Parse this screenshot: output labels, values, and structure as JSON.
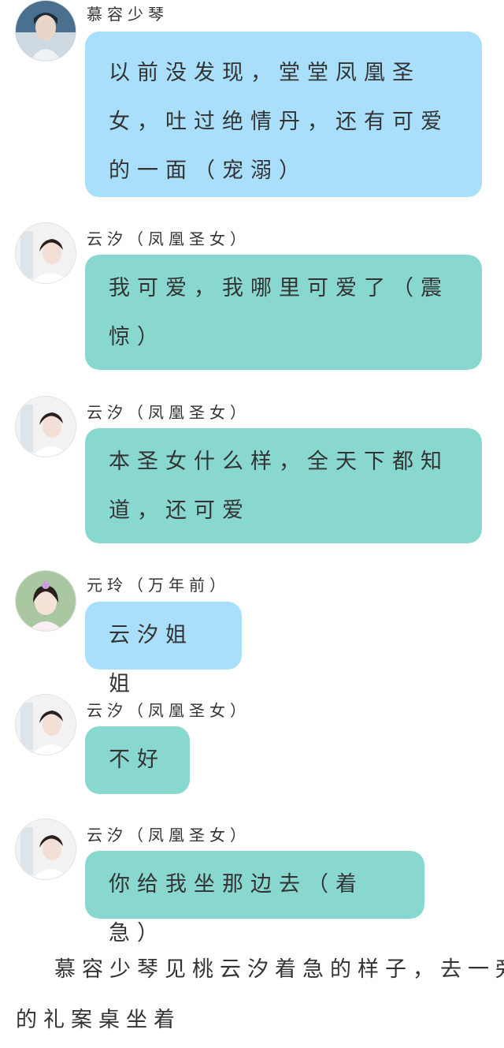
{
  "messages": [
    {
      "speaker": "慕容少琴",
      "text": "以前没发现，堂堂凤凰圣女，吐过绝情丹，还有可爱的一面（宠溺）",
      "color": "#a9dffb",
      "avatar": "male-portrait"
    },
    {
      "speaker": "云汐（凤凰圣女）",
      "text": "我可爱，我哪里可爱了（震惊）",
      "color": "#89d8cf",
      "avatar": "female-portrait"
    },
    {
      "speaker": "云汐（凤凰圣女）",
      "text": "本圣女什么样，全天下都知道，还可爱",
      "color": "#89d8cf",
      "avatar": "female-portrait"
    },
    {
      "speaker": "元玲（万年前）",
      "text": "云汐姐姐",
      "color": "#a9dffb",
      "avatar": "female-portrait-2"
    },
    {
      "speaker": "云汐（凤凰圣女）",
      "text": "不好",
      "color": "#89d8cf",
      "avatar": "female-portrait"
    },
    {
      "speaker": "云汐（凤凰圣女）",
      "text": "你给我坐那边去（着急）",
      "color": "#89d8cf",
      "avatar": "female-portrait"
    }
  ],
  "narration": {
    "line1": "　慕容少琴见桃云汐着急的样子，去一旁",
    "line2": "的礼案桌坐着"
  }
}
